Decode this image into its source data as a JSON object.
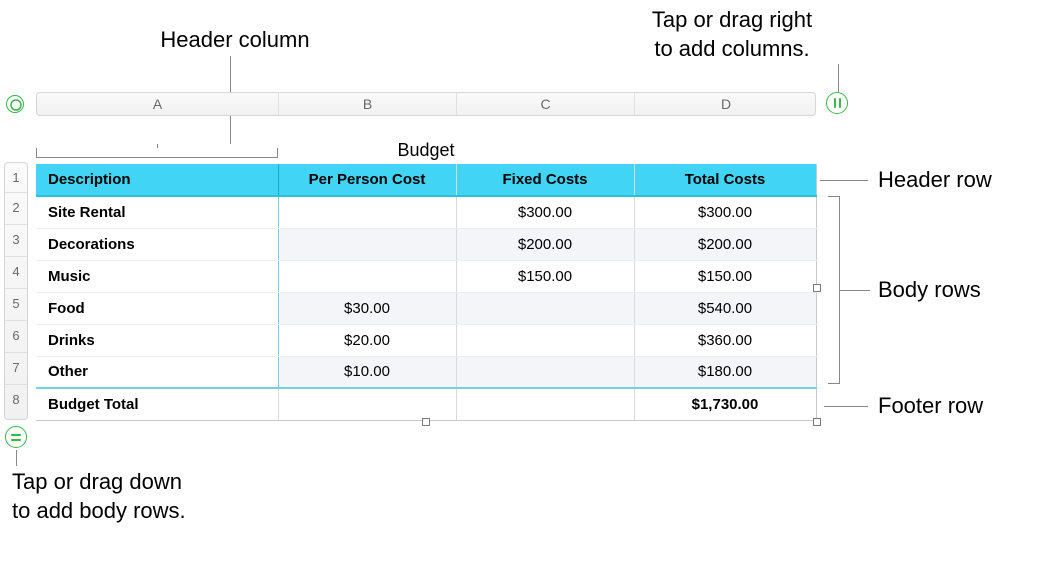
{
  "callouts": {
    "header_column": "Header column",
    "add_columns": "Tap or drag right\nto add columns.",
    "header_row": "Header row",
    "body_rows": "Body rows",
    "footer_row": "Footer row",
    "add_body_rows": "Tap or drag down\nto add body rows."
  },
  "table_title": "Budget",
  "col_letters": [
    "A",
    "B",
    "C",
    "D"
  ],
  "row_numbers": [
    "1",
    "2",
    "3",
    "4",
    "5",
    "6",
    "7",
    "8"
  ],
  "headers": {
    "col_a": "Description",
    "col_b": "Per Person Cost",
    "col_c": "Fixed Costs",
    "col_d": "Total Costs"
  },
  "rows": [
    {
      "desc": "Site Rental",
      "per": "",
      "fixed": "$300.00",
      "total": "$300.00"
    },
    {
      "desc": "Decorations",
      "per": "",
      "fixed": "$200.00",
      "total": "$200.00"
    },
    {
      "desc": "Music",
      "per": "",
      "fixed": "$150.00",
      "total": "$150.00"
    },
    {
      "desc": "Food",
      "per": "$30.00",
      "fixed": "",
      "total": "$540.00"
    },
    {
      "desc": "Drinks",
      "per": "$20.00",
      "fixed": "",
      "total": "$360.00"
    },
    {
      "desc": "Other",
      "per": "$10.00",
      "fixed": "",
      "total": "$180.00"
    }
  ],
  "footer": {
    "desc": "Budget Total",
    "per": "",
    "fixed": "",
    "total": "$1,730.00"
  },
  "chart_data": {
    "type": "table",
    "title": "Budget",
    "columns": [
      "Description",
      "Per Person Cost",
      "Fixed Costs",
      "Total Costs"
    ],
    "rows": [
      [
        "Site Rental",
        null,
        300.0,
        300.0
      ],
      [
        "Decorations",
        null,
        200.0,
        200.0
      ],
      [
        "Music",
        null,
        150.0,
        150.0
      ],
      [
        "Food",
        30.0,
        null,
        540.0
      ],
      [
        "Drinks",
        20.0,
        null,
        360.0
      ],
      [
        "Other",
        10.0,
        null,
        180.0
      ]
    ],
    "footer": [
      "Budget Total",
      null,
      null,
      1730.0
    ]
  }
}
